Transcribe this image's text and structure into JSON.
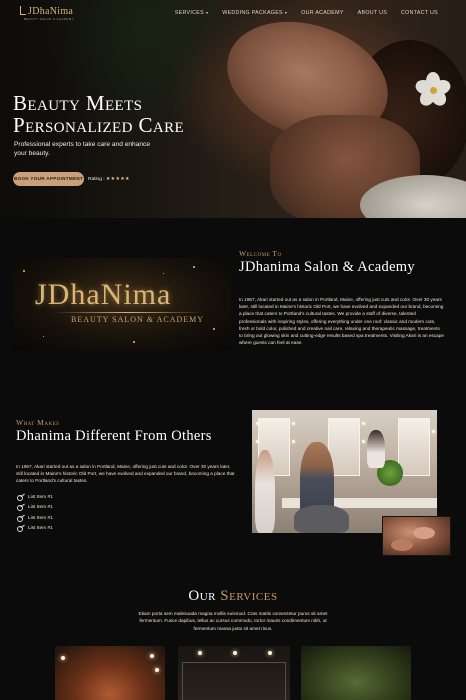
{
  "brand": {
    "logo_text": "JDhaNima",
    "logo_tagline": "BEAUTY SALON & ACADEMY"
  },
  "nav": {
    "items": [
      {
        "label": "SERVICES",
        "has_dropdown": true
      },
      {
        "label": "WEDDING PACKAGES",
        "has_dropdown": true
      },
      {
        "label": "OUR ACADEMY",
        "has_dropdown": false
      },
      {
        "label": "ABOUT US",
        "has_dropdown": false
      },
      {
        "label": "CONTACT US",
        "has_dropdown": false
      }
    ],
    "dropdown_icon": "chevron-down-icon"
  },
  "hero": {
    "title_line1": "Beauty Meets",
    "title_line2": "Personalized Care",
    "subtitle": "Professional experts to take care and enhance your beauty.",
    "cta_label": "BOOK YOUR APPOINTMENT",
    "rating_label": "Rating :",
    "rating_value": 5,
    "rating_max": 5,
    "stars": "★★★★★"
  },
  "welcome": {
    "eyebrow": "Welcome To",
    "title": "JDhanima Salon & Academy",
    "image_brand": "JDhaNima",
    "image_tagline": "BEAUTY SALON & ACADEMY",
    "body": "In 1967, Akari started out as a salon in Portland, Maine, offering just cuts and color. Over 30 years later, still located in Maine's historic Old Port, we have evolved and expanded our brand, becoming a place that caters to Portland's cultural tastes. We provide a staff of diverse, talented professionals with inspiring styles, offering everything under one roof: classic and modern cuts, fresh or bold color, polished and creative nail care, relaxing and therapeutic massage, treatments to bring out glowing skin and cutting-edge results based spa treatments. Visiting Akari is an escape where guests can feel at ease."
  },
  "different": {
    "eyebrow": "What Makes",
    "title": "Dhanima Different From Others",
    "body": "In 1967, Akari started out as a salon in Portland, Maine, offering just cuts and color. Over 30 years later, still located in Maine's historic Old Port, we have evolved and expanded our brand, becoming a place that caters to Portland's cultural tastes.",
    "list": [
      "List Item #1",
      "List Item #1",
      "List Item #1",
      "List Item #1"
    ],
    "list_icon": "scissors-icon"
  },
  "services": {
    "title_word1": "Our",
    "title_word2": "Services",
    "description": "Etiam porta sem malesuada magna mollis euismod. Cras mattis consectetur purus sit amet fermentum. Fusce dapibus, tellus ac cursus commodo, tortor mauris condimentum nibh, ut fermentum massa justo sit amet risus."
  },
  "colors": {
    "accent": "#c79b64",
    "button": "#c8a17a",
    "background": "#0b0b0b"
  }
}
